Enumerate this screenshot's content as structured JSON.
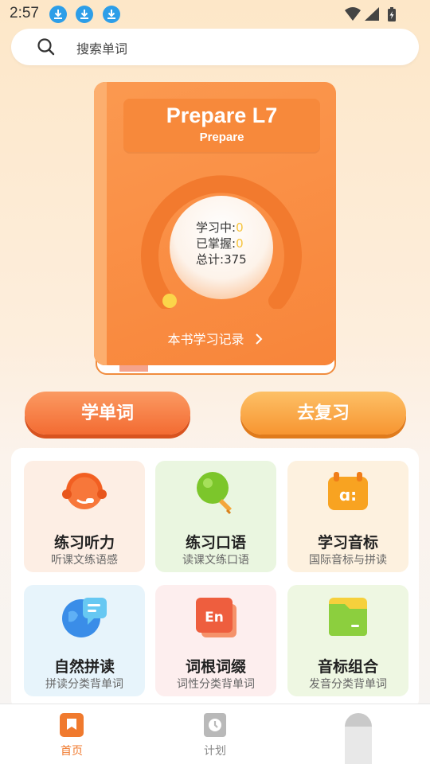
{
  "status_bar": {
    "time": "2:57",
    "download_icons": [
      "download-icon",
      "download-icon",
      "download-icon"
    ],
    "system_icons": [
      "wifi-icon",
      "signal-icon",
      "battery-charging-icon"
    ]
  },
  "search": {
    "placeholder": "搜索单词",
    "icon": "search-icon"
  },
  "book": {
    "title": "Prepare L7",
    "subtitle": "Prepare",
    "stats": {
      "learning_label": "学习中:",
      "learning_value": "0",
      "mastered_label": "已掌握:",
      "mastered_value": "0",
      "total_label": "总计:",
      "total_value": "375"
    },
    "record_link": "本书学习记录"
  },
  "actions": {
    "learn_words": "学单词",
    "review": "去复习"
  },
  "features": [
    {
      "title": "练习听力",
      "subtitle": "听课文练语感",
      "icon": "headset-icon"
    },
    {
      "title": "练习口语",
      "subtitle": "读课文练口语",
      "icon": "microphone-icon"
    },
    {
      "title": "学习音标",
      "subtitle": "国际音标与拼读",
      "icon": "phonetic-icon"
    },
    {
      "title": "自然拼读",
      "subtitle": "拼读分类背单词",
      "icon": "globe-chat-icon"
    },
    {
      "title": "词根词缀",
      "subtitle": "词性分类背单词",
      "icon": "en-card-icon"
    },
    {
      "title": "音标组合",
      "subtitle": "发音分类背单词",
      "icon": "folder-icon"
    }
  ],
  "tab_bar": [
    {
      "label": "首页",
      "icon": "home-book-icon",
      "active": true
    },
    {
      "label": "计划",
      "icon": "plan-clock-icon",
      "active": false
    },
    {
      "label": "",
      "icon": "profile-icon",
      "active": false
    }
  ],
  "colors": {
    "accent": "#f8853a",
    "active_tab": "#f07a2e",
    "stat_highlight": "#f6c33a"
  }
}
